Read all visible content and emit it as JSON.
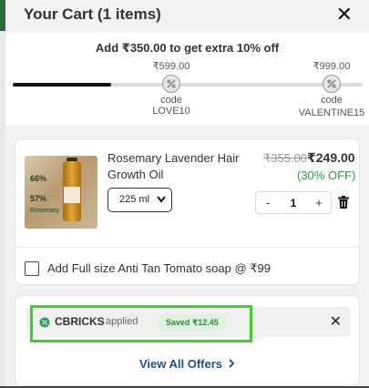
{
  "header": {
    "title": "Your Cart (1 items)",
    "close_icon": "close-icon"
  },
  "progress": {
    "goal_text": "Add ₹350.00 to get extra 10% off",
    "fill_fraction": 0.28,
    "milestones": [
      {
        "amount": "₹599.00",
        "code_line1": "code LOVE10",
        "code_line2": "",
        "icon": "discount-badge-icon"
      },
      {
        "amount": "₹999.00",
        "code_line1": "code",
        "code_line2": "VALENTINE15",
        "icon": "discount-badge-icon"
      }
    ]
  },
  "product": {
    "name": "Rosemary Lavender Hair Growth Oil",
    "thumb_text": [
      "66%",
      "57%",
      "Rosemary"
    ],
    "size_selected": "225 ml",
    "price_original": "₹355.00",
    "price_current": "₹249.00",
    "discount": "(30% OFF)",
    "quantity": "1",
    "minus": "-",
    "plus": "+",
    "addon_label": "Add Full size Anti Tan Tomato soap @ ₹99"
  },
  "offers": {
    "coupon_code": "CBRICKS",
    "applied_text": "applied",
    "saved_text": "Saved ₹12.45",
    "view_all_label": "View All Offers",
    "highlight_color": "#39d126"
  }
}
